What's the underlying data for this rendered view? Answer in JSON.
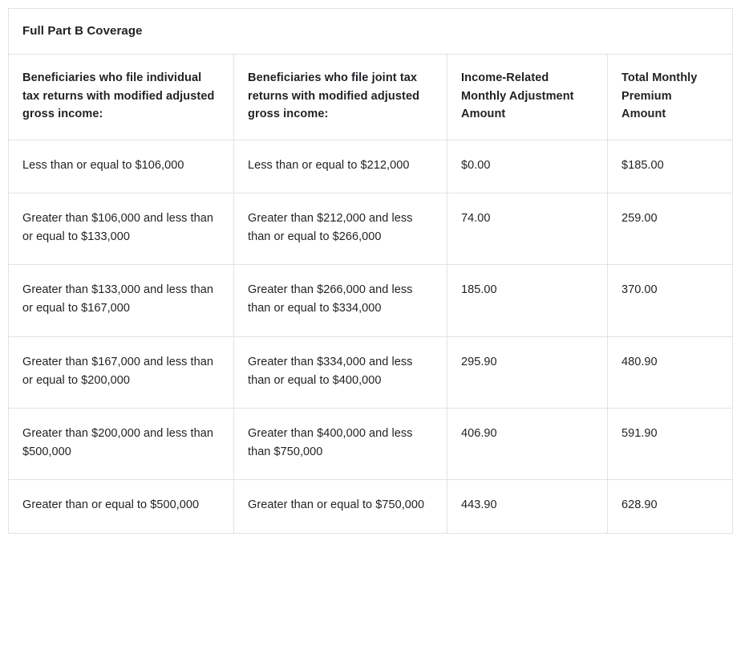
{
  "table": {
    "caption": "Full Part B Coverage",
    "columns": [
      "Beneficiaries who file individual tax returns with modified adjusted gross income:",
      "Beneficiaries who file joint tax returns with modified adjusted gross income:",
      "Income-Related Monthly Adjustment Amount",
      "Total Monthly Premium Amount"
    ],
    "rows": [
      {
        "individual": "Less than or equal to $106,000",
        "joint": "Less than or equal to $212,000",
        "irmaa": "$0.00",
        "total": "$185.00"
      },
      {
        "individual": "Greater than $106,000 and less than or equal to $133,000",
        "joint": "Greater than $212,000 and less than or equal to $266,000",
        "irmaa": "74.00",
        "total": "259.00"
      },
      {
        "individual": "Greater than $133,000 and less than or equal to $167,000",
        "joint": "Greater than $266,000 and less than or equal to $334,000",
        "irmaa": "185.00",
        "total": "370.00"
      },
      {
        "individual": "Greater than $167,000 and less than or equal to $200,000",
        "joint": "Greater than $334,000 and less than or equal to $400,000",
        "irmaa": "295.90",
        "total": "480.90"
      },
      {
        "individual": "Greater than $200,000 and less than $500,000",
        "joint": "Greater than $400,000 and less than $750,000",
        "irmaa": "406.90",
        "total": "591.90"
      },
      {
        "individual": "Greater than or equal to $500,000",
        "joint": "Greater than or equal to $750,000",
        "irmaa": "443.90",
        "total": "628.90"
      }
    ]
  },
  "colors": {
    "border": "#e2e2e2",
    "text": "#1f2124",
    "background": "#ffffff"
  }
}
